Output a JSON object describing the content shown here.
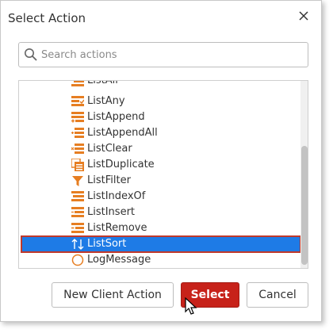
{
  "dialog": {
    "title": "Select Action"
  },
  "search": {
    "placeholder": "Search actions",
    "value": ""
  },
  "list": {
    "items": [
      {
        "label": "ListAll",
        "icon": "list-icon"
      },
      {
        "label": "ListAny",
        "icon": "list-icon"
      },
      {
        "label": "ListAppend",
        "icon": "list-icon"
      },
      {
        "label": "ListAppendAll",
        "icon": "list-icon"
      },
      {
        "label": "ListClear",
        "icon": "list-icon"
      },
      {
        "label": "ListDuplicate",
        "icon": "list-duplicate-icon"
      },
      {
        "label": "ListFilter",
        "icon": "filter-icon"
      },
      {
        "label": "ListIndexOf",
        "icon": "list-icon"
      },
      {
        "label": "ListInsert",
        "icon": "list-icon"
      },
      {
        "label": "ListRemove",
        "icon": "list-icon"
      },
      {
        "label": "ListSort",
        "icon": "sort-icon"
      },
      {
        "label": "LogMessage",
        "icon": "circle-icon"
      }
    ],
    "selected": "ListSort"
  },
  "buttons": {
    "new_client_action": "New Client Action",
    "select": "Select",
    "cancel": "Cancel"
  },
  "colors": {
    "accent_orange": "#e67e22",
    "selection_blue": "#1e7be6",
    "selection_border": "#c0392b",
    "primary_button": "#c7221a"
  }
}
